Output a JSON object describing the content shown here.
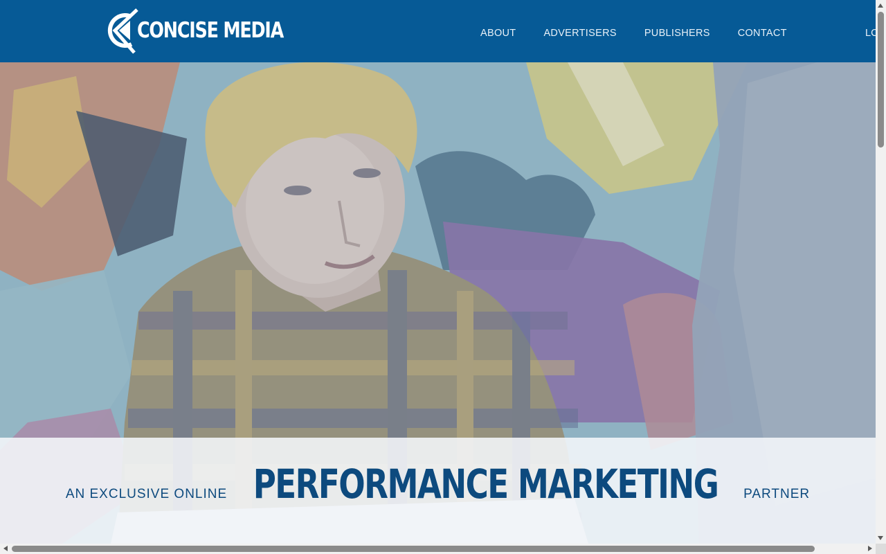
{
  "brand": {
    "name": "CONCISE MEDIA",
    "logo_icon": "concise-c-logo-icon"
  },
  "nav": {
    "items": [
      {
        "label": "ABOUT"
      },
      {
        "label": "ADVERTISERS"
      },
      {
        "label": "PUBLISHERS"
      },
      {
        "label": "CONTACT"
      }
    ],
    "login_label": "LC"
  },
  "hero": {
    "image_alt": "hero-photo",
    "tagline_prefix": "AN EXCLUSIVE ONLINE",
    "tagline_main": "PERFORMANCE MARKETING",
    "tagline_suffix": "PARTNER"
  },
  "colors": {
    "header_bg": "#065a96",
    "tagline_text": "#0d4a7e",
    "nav_text": "#e9f1f8"
  }
}
